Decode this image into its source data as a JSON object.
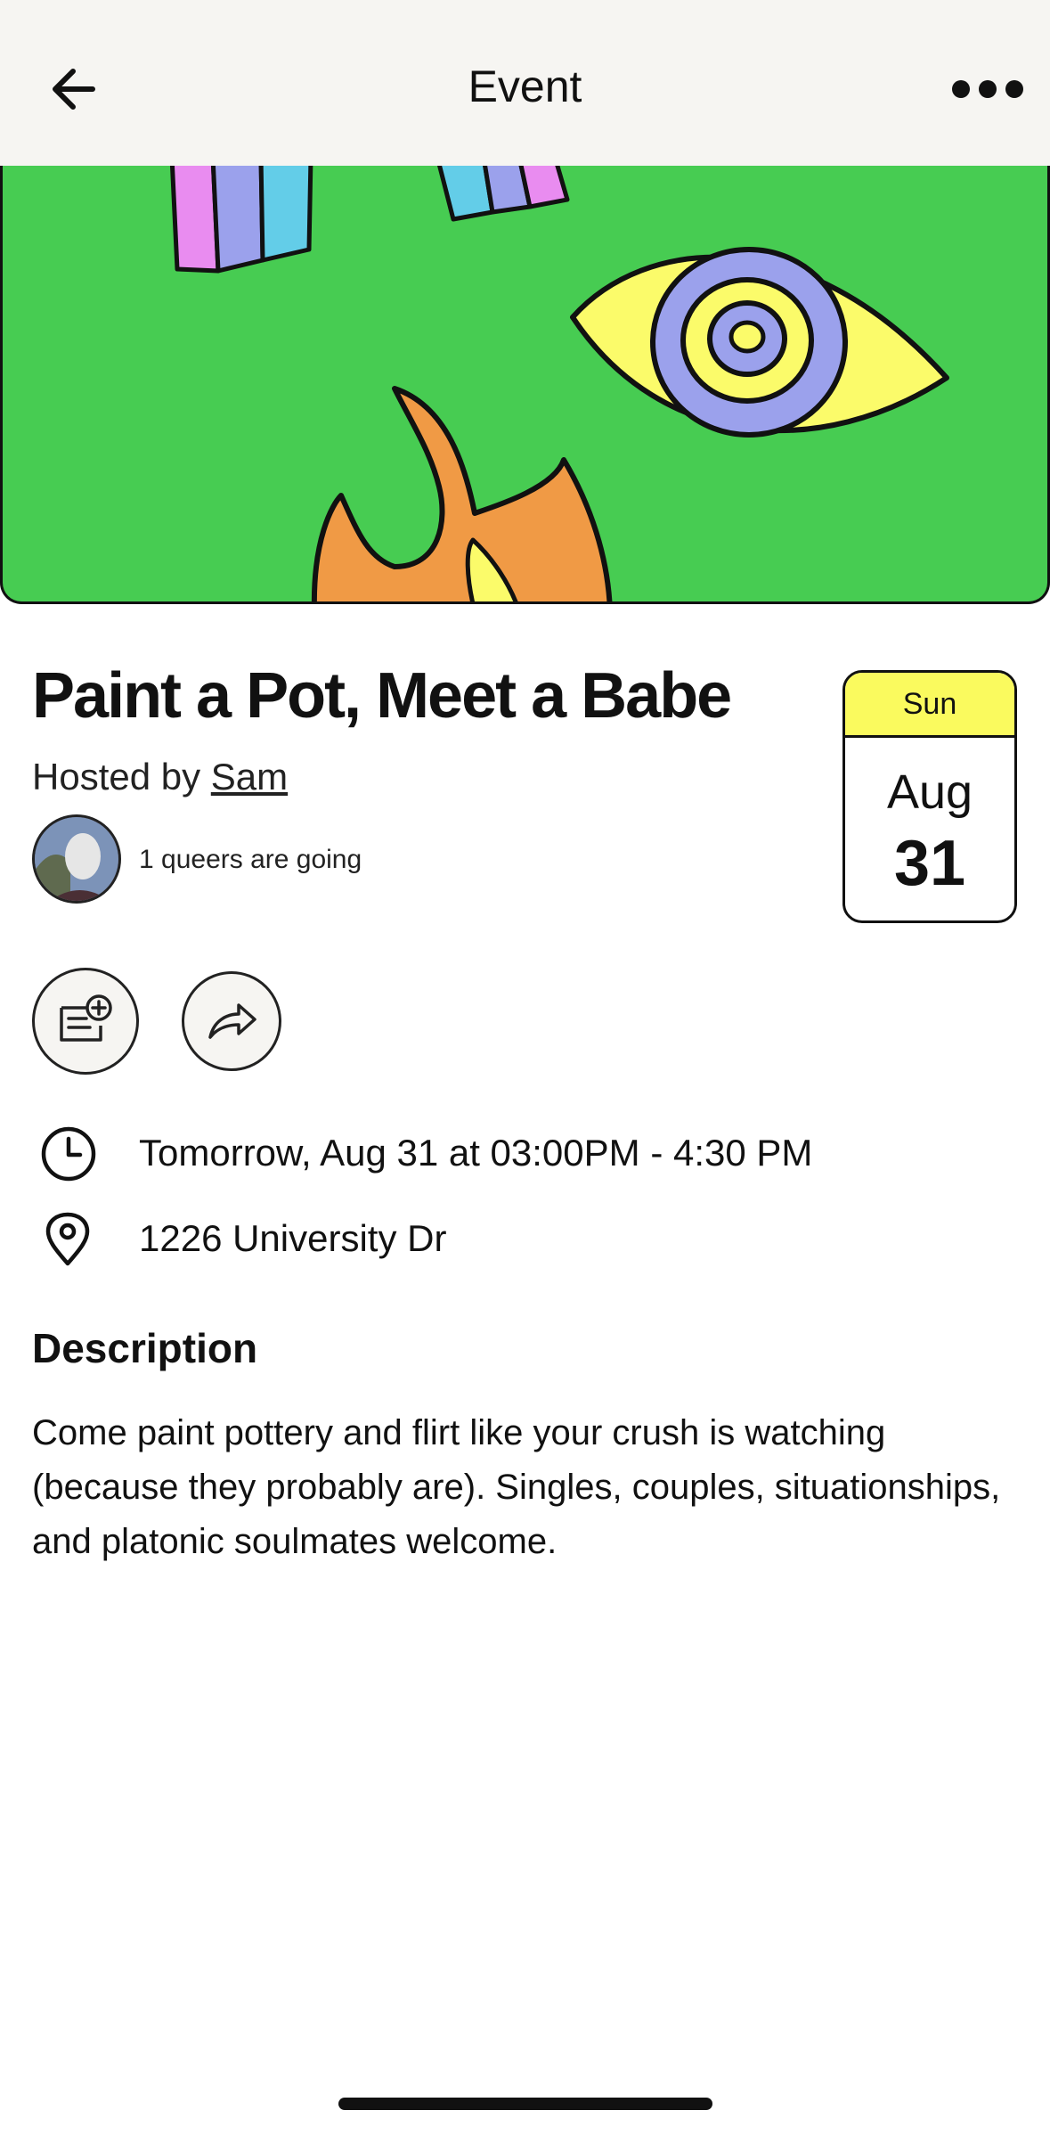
{
  "header": {
    "title": "Event",
    "back_icon": "arrow-left-icon",
    "more_icon": "more-horizontal-icon"
  },
  "colors": {
    "banner_bg": "#47cc52",
    "date_header": "#fafa5e",
    "header_bg": "#f6f5f2"
  },
  "event": {
    "title": "Paint a Pot, Meet a Babe",
    "hosted_prefix": "Hosted by ",
    "host_name": "Sam",
    "attendees_text": "1 queers are going",
    "date": {
      "weekday": "Sun",
      "month": "Aug",
      "day": "31"
    }
  },
  "actions": {
    "add_icon": "add-to-calendar-icon",
    "share_icon": "share-icon"
  },
  "details": {
    "time": "Tomorrow, Aug 31 at 03:00PM - 4:30 PM",
    "location": "1226 University Dr"
  },
  "description": {
    "heading": "Description",
    "body": "Come paint pottery and flirt like your crush is watching (because they probably are). Singles, couples, situationships, and platonic soulmates welcome."
  }
}
